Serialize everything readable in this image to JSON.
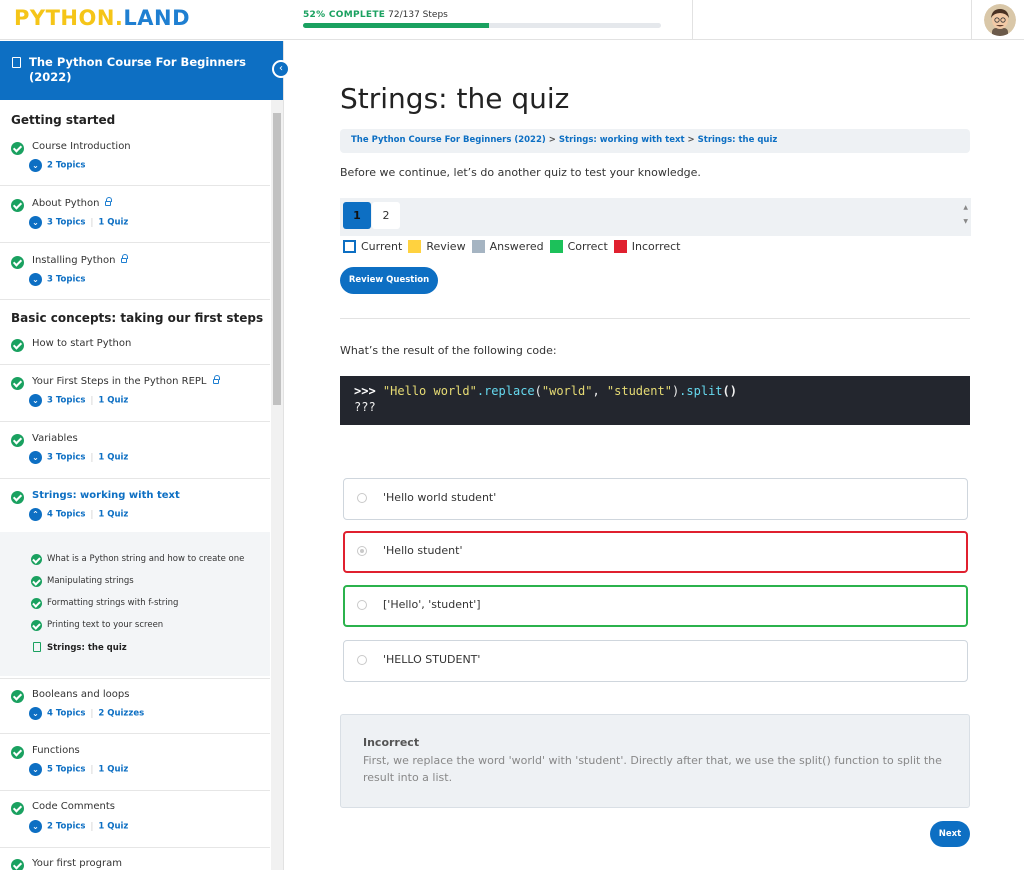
{
  "header": {
    "logo_part1": "PYTHON.",
    "logo_part2": "LAND",
    "progress_percent_label": "52% COMPLETE",
    "progress_steps": "72/137 Steps",
    "progress_fraction": 0.52
  },
  "sidebar": {
    "course_title": "The Python Course For Beginners (2022)",
    "collapse_icon": "chevron-left-icon",
    "sections": [
      {
        "title": "Getting started"
      },
      {
        "title": "Basic concepts: taking our first steps"
      }
    ],
    "lessons": [
      {
        "title": "Course Introduction",
        "topics": "2 Topics",
        "quiz": ""
      },
      {
        "title": "About Python",
        "topics": "3 Topics",
        "quiz": "1 Quiz"
      },
      {
        "title": "Installing Python",
        "topics": "3 Topics",
        "quiz": ""
      },
      {
        "title": "How to start Python",
        "topics": "",
        "quiz": ""
      },
      {
        "title": "Your First Steps in the Python REPL",
        "topics": "3 Topics",
        "quiz": "1 Quiz"
      },
      {
        "title": "Variables",
        "topics": "3 Topics",
        "quiz": "1 Quiz"
      },
      {
        "title": "Strings: working with text",
        "topics": "4 Topics",
        "quiz": "1 Quiz"
      },
      {
        "title": "Booleans and loops",
        "topics": "4 Topics",
        "quiz": "2 Quizzes"
      },
      {
        "title": "Functions",
        "topics": "5 Topics",
        "quiz": "1 Quiz"
      },
      {
        "title": "Code Comments",
        "topics": "2 Topics",
        "quiz": "1 Quiz"
      },
      {
        "title": "Your first program",
        "topics": "",
        "quiz": ""
      }
    ],
    "sub_items": [
      "What is a Python string and how to create one",
      "Manipulating strings",
      "Formatting strings with f-string",
      "Printing text to your screen",
      "Strings: the quiz"
    ]
  },
  "main": {
    "title": "Strings: the quiz",
    "breadcrumb": [
      "The Python Course For Beginners (2022)",
      "Strings: working with text",
      "Strings: the quiz"
    ],
    "breadcrumb_sep": ">",
    "intro": "Before we continue, let’s do another quiz to test your knowledge.",
    "question_numbers": [
      "1",
      "2"
    ],
    "legend": [
      {
        "label": "Current",
        "color": "#ffffff",
        "border": "#0d6fc3"
      },
      {
        "label": "Review",
        "color": "#ffd23f",
        "border": "#ffd23f"
      },
      {
        "label": "Answered",
        "color": "#a5b4c2",
        "border": "#a5b4c2"
      },
      {
        "label": "Correct",
        "color": "#1cc15a",
        "border": "#1cc15a"
      },
      {
        "label": "Incorrect",
        "color": "#e0202f",
        "border": "#e0202f"
      }
    ],
    "review_button": "Review Question",
    "question": "What’s the result of the following code:",
    "code_line1_prompt": ">>>",
    "code_line1_str1": "\"Hello world\"",
    "code_line1_fn1": ".replace",
    "code_line1_paren_open": "(",
    "code_line1_str2": "\"world\"",
    "code_line1_comma": ", ",
    "code_line1_str3": "\"student\"",
    "code_line1_paren_close": ")",
    "code_line1_fn2": ".split",
    "code_line1_call": "()",
    "code_line2": "???",
    "answers": [
      {
        "text": "'Hello world student'",
        "state": "normal"
      },
      {
        "text": "'Hello student'",
        "state": "wrong"
      },
      {
        "text": "['Hello', 'student']",
        "state": "right"
      },
      {
        "text": "'HELLO STUDENT'",
        "state": "normal"
      }
    ],
    "feedback_title": "Incorrect",
    "feedback_text": "First, we replace the word 'world' with 'student'. Directly after that, we use the split() function to split the result into a list.",
    "next_button": "Next"
  }
}
